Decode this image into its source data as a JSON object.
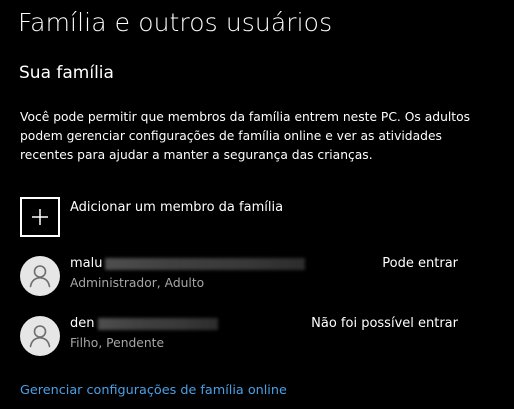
{
  "colors": {
    "background": "#000000",
    "text": "#ffffff",
    "secondary_text": "#a6a6a6",
    "link": "#4aa0e6",
    "avatar_bg": "#e6e6e6",
    "avatar_icon": "#6e6e6e"
  },
  "page": {
    "title": "Família e outros usuários"
  },
  "family": {
    "section_title": "Sua família",
    "description": "Você pode permitir que membros da família entrem neste PC. Os adultos podem gerenciar configurações de família online e ver as atividades recentes para ajudar a manter a segurança das crianças.",
    "add_member_label": "Adicionar um membro da família",
    "add_member_icon": "plus-icon",
    "members": [
      {
        "name_visible": "malu",
        "name_redacted": true,
        "role": "Administrador, Adulto",
        "status": "Pode entrar",
        "avatar_icon": "person-icon"
      },
      {
        "name_visible": "den",
        "name_redacted": true,
        "role": "Filho, Pendente",
        "status": "Não foi possível entrar",
        "avatar_icon": "person-icon"
      }
    ],
    "manage_link": "Gerenciar configurações de família online"
  }
}
